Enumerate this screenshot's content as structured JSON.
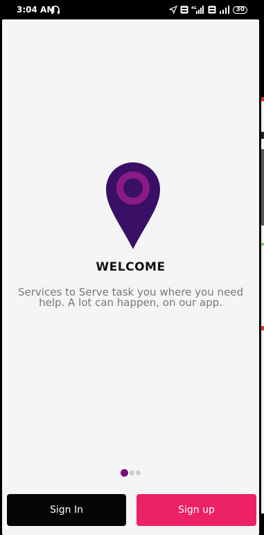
{
  "status_bar": {
    "time": "3:04 AM",
    "battery": "30",
    "icons": [
      "headphone-icon",
      "location-arrow-icon",
      "volte-icon",
      "signal-4g-icon",
      "volte-icon",
      "signal-icon",
      "battery-icon"
    ]
  },
  "onboarding": {
    "title": "WELCOME",
    "description": "Services to Serve task you where you need help. A lot can happen, on our app.",
    "page_indicator": {
      "current": 1,
      "total": 3
    },
    "pin_color": "#3a0f66",
    "pin_ring_color": "#8a1a88"
  },
  "actions": {
    "sign_in_label": "Sign In",
    "sign_up_label": "Sign up",
    "sign_in_color": "#050505",
    "sign_up_color": "#ec2166"
  }
}
